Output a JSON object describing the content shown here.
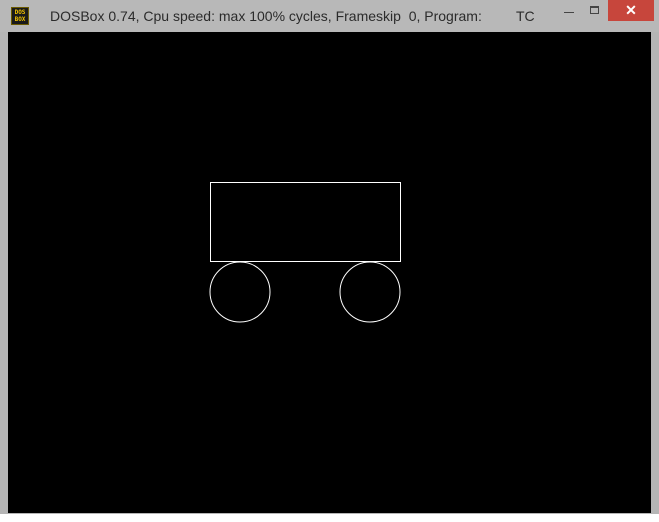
{
  "window": {
    "title": "DOSBox 0.74, Cpu speed: max 100% cycles, Frameskip  0, Program:",
    "program": "TC",
    "icon_name": "dosbox-icon",
    "icon_text_top": "DOS",
    "icon_text_bottom": "BOX",
    "controls": {
      "minimize_icon": "minimize-icon",
      "maximize_icon": "maximize-icon",
      "close_icon": "close-icon",
      "close_glyph": "✕"
    },
    "close_color": "#c7463c"
  },
  "screen": {
    "background": "#000000",
    "drawing_color": "#ffffff",
    "shapes": [
      "rectangle",
      "circle",
      "circle"
    ]
  }
}
